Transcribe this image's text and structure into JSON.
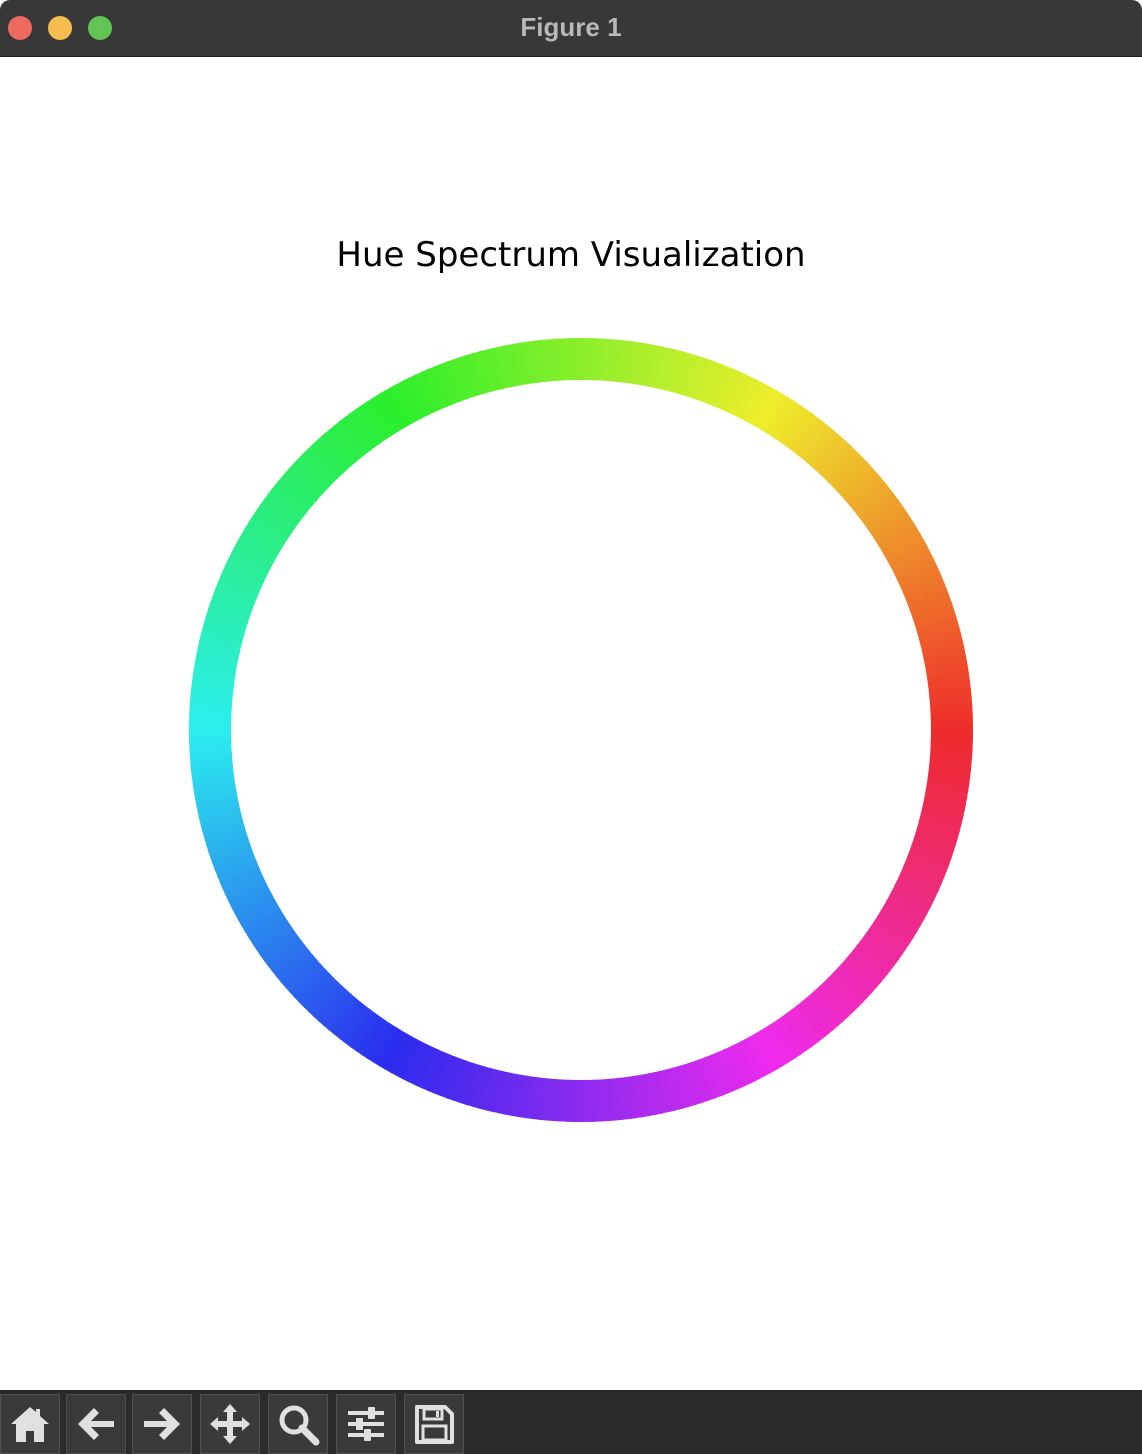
{
  "window": {
    "title": "Figure 1",
    "traffic_lights": {
      "close": "#ee6a5f",
      "minimize": "#f5bd4f",
      "maximize": "#61c454"
    }
  },
  "toolbar": {
    "buttons": [
      {
        "name": "home",
        "icon": "home-icon"
      },
      {
        "name": "back",
        "icon": "arrow-left-icon"
      },
      {
        "name": "forward",
        "icon": "arrow-right-icon"
      },
      {
        "name": "pan",
        "icon": "move-icon"
      },
      {
        "name": "zoom",
        "icon": "magnifier-icon"
      },
      {
        "name": "configure-subplots",
        "icon": "sliders-icon"
      },
      {
        "name": "save",
        "icon": "floppy-disk-icon"
      }
    ]
  },
  "chart_data": {
    "type": "ring",
    "title": "Hue Spectrum Visualization",
    "hue_range": [
      0,
      360
    ],
    "hue_start_direction": "right",
    "hue_direction": "counterclockwise",
    "saturation": 0.85,
    "lightness": 0.55,
    "axes_visible": false,
    "grid": false
  }
}
